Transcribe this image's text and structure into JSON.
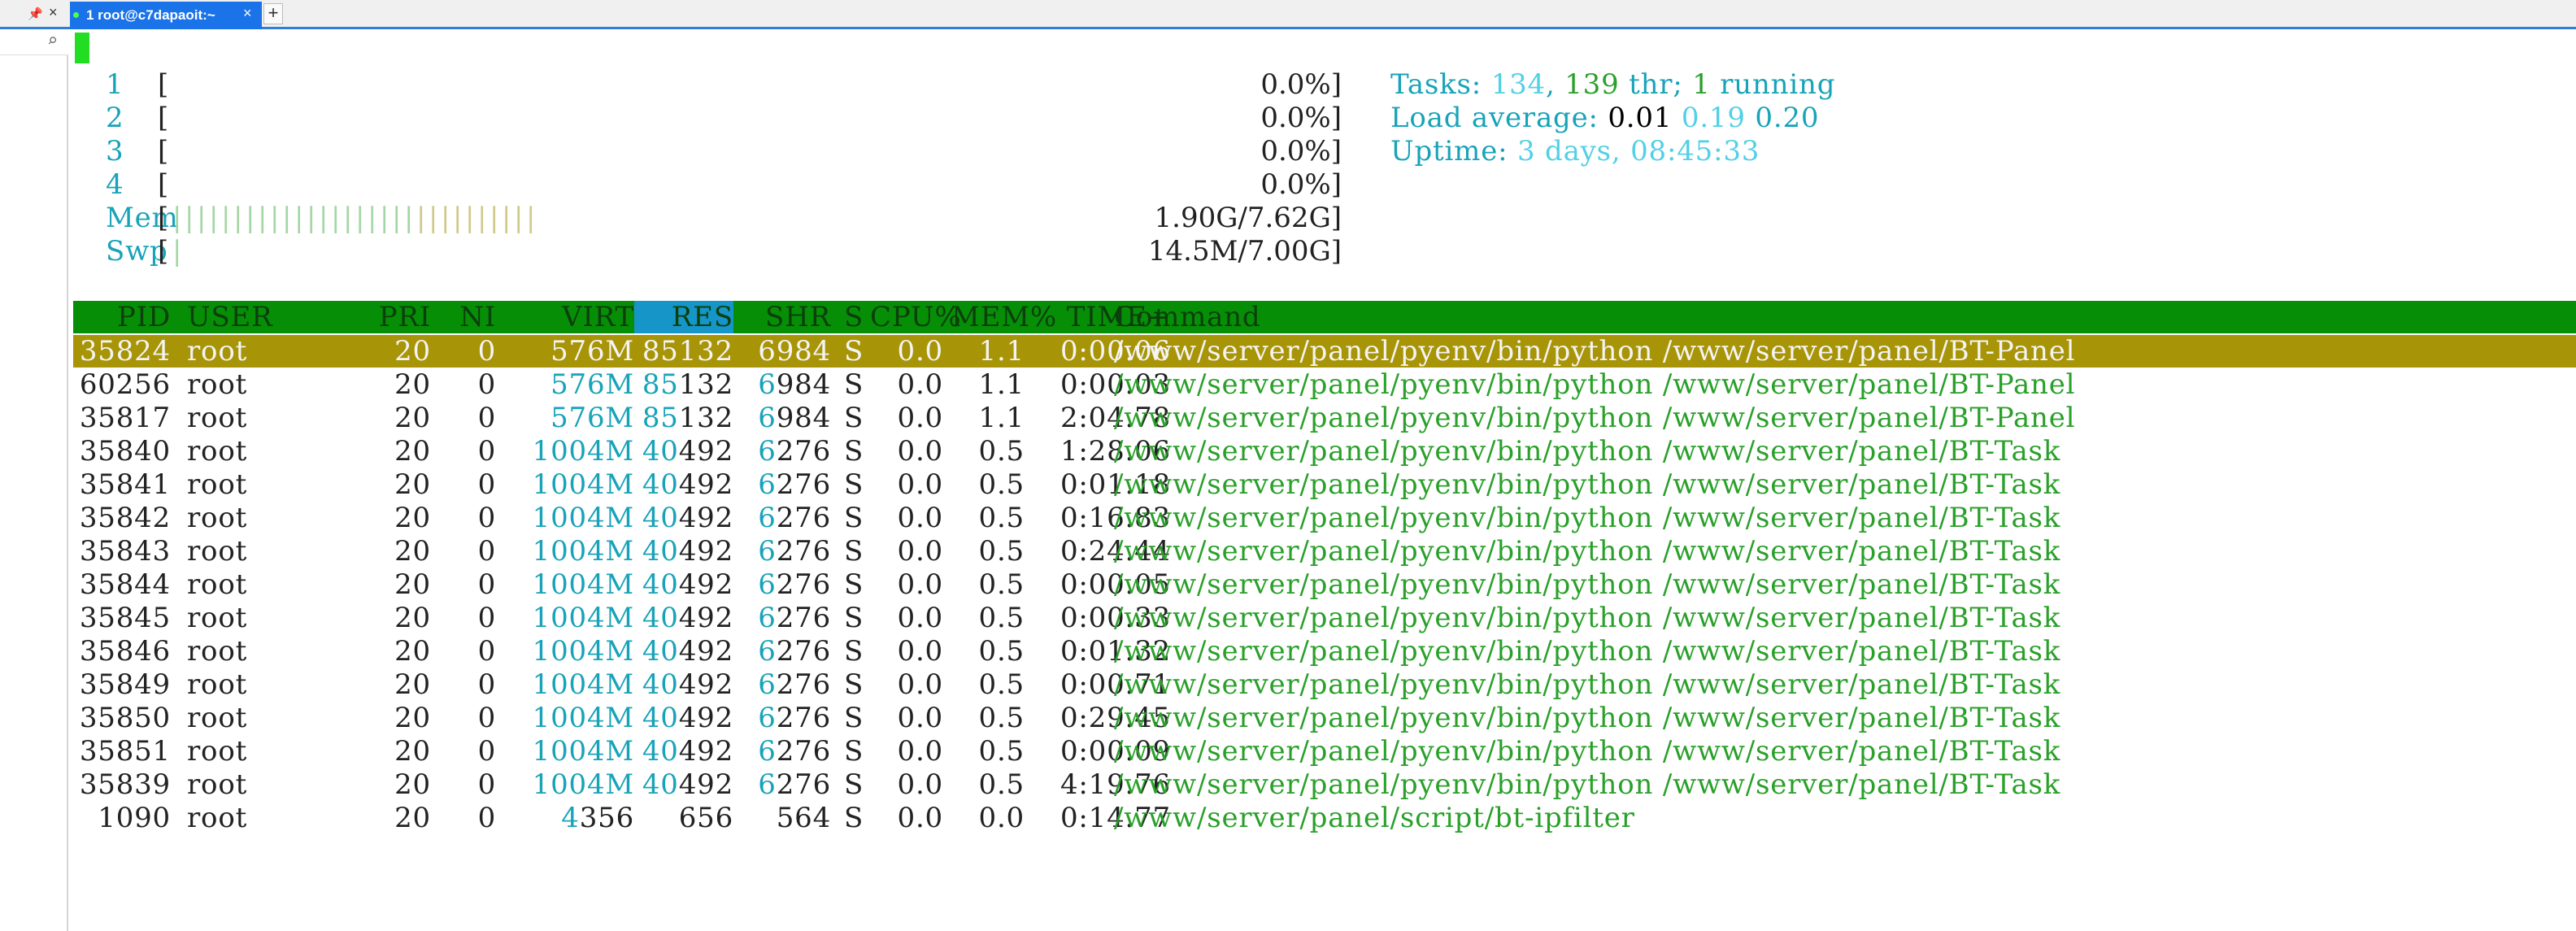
{
  "window": {
    "pin_icon": "pin-icon",
    "tab_title": "1 root@c7dapaoit:~",
    "tab_close": "×",
    "new_tab": "+"
  },
  "cpu_meters": [
    {
      "label": "1",
      "value": "0.0%"
    },
    {
      "label": "2",
      "value": "0.0%"
    },
    {
      "label": "3",
      "value": "0.0%"
    },
    {
      "label": "4",
      "value": "0.0%"
    }
  ],
  "mem_meter": {
    "label": "Mem",
    "value": "1.90G/7.62G",
    "fill_fraction": 0.25
  },
  "swp_meter": {
    "label": "Swp",
    "value": "14.5M/7.00G",
    "fill_fraction": 0.002
  },
  "stats": {
    "tasks_label": "Tasks:",
    "tasks_count": "134",
    "threads": "139",
    "thr_label": "thr;",
    "running_count": "1",
    "running_label": "running",
    "load_label": "Load average:",
    "load_1": "0.01",
    "load_5": "0.19",
    "load_15": "0.20",
    "uptime_label": "Uptime:",
    "uptime_value": "3 days, 08:45:33"
  },
  "columns": [
    "PID",
    "USER",
    "PRI",
    "NI",
    "VIRT",
    "RES",
    "SHR",
    "S",
    "CPU%",
    "MEM%",
    "TIME+",
    "Command"
  ],
  "sorted_column": "RES",
  "processes": [
    {
      "pid": "35824",
      "user": "root",
      "pri": "20",
      "ni": "0",
      "virt": "576M",
      "res": "85132",
      "shr": "6984",
      "s": "S",
      "cpu": "0.0",
      "mem": "1.1",
      "time": "0:00.06",
      "cmd": "/www/server/panel/pyenv/bin/python /www/server/panel/BT-Panel",
      "selected": true
    },
    {
      "pid": "60256",
      "user": "root",
      "pri": "20",
      "ni": "0",
      "virt": "576M",
      "res": "85132",
      "shr": "6984",
      "s": "S",
      "cpu": "0.0",
      "mem": "1.1",
      "time": "0:00.03",
      "cmd": "/www/server/panel/pyenv/bin/python /www/server/panel/BT-Panel"
    },
    {
      "pid": "35817",
      "user": "root",
      "pri": "20",
      "ni": "0",
      "virt": "576M",
      "res": "85132",
      "shr": "6984",
      "s": "S",
      "cpu": "0.0",
      "mem": "1.1",
      "time": "2:04.78",
      "cmd": "/www/server/panel/pyenv/bin/python /www/server/panel/BT-Panel"
    },
    {
      "pid": "35840",
      "user": "root",
      "pri": "20",
      "ni": "0",
      "virt": "1004M",
      "res": "40492",
      "shr": "6276",
      "s": "S",
      "cpu": "0.0",
      "mem": "0.5",
      "time": "1:28.06",
      "cmd": "/www/server/panel/pyenv/bin/python /www/server/panel/BT-Task"
    },
    {
      "pid": "35841",
      "user": "root",
      "pri": "20",
      "ni": "0",
      "virt": "1004M",
      "res": "40492",
      "shr": "6276",
      "s": "S",
      "cpu": "0.0",
      "mem": "0.5",
      "time": "0:01.18",
      "cmd": "/www/server/panel/pyenv/bin/python /www/server/panel/BT-Task"
    },
    {
      "pid": "35842",
      "user": "root",
      "pri": "20",
      "ni": "0",
      "virt": "1004M",
      "res": "40492",
      "shr": "6276",
      "s": "S",
      "cpu": "0.0",
      "mem": "0.5",
      "time": "0:16.83",
      "cmd": "/www/server/panel/pyenv/bin/python /www/server/panel/BT-Task"
    },
    {
      "pid": "35843",
      "user": "root",
      "pri": "20",
      "ni": "0",
      "virt": "1004M",
      "res": "40492",
      "shr": "6276",
      "s": "S",
      "cpu": "0.0",
      "mem": "0.5",
      "time": "0:24.44",
      "cmd": "/www/server/panel/pyenv/bin/python /www/server/panel/BT-Task"
    },
    {
      "pid": "35844",
      "user": "root",
      "pri": "20",
      "ni": "0",
      "virt": "1004M",
      "res": "40492",
      "shr": "6276",
      "s": "S",
      "cpu": "0.0",
      "mem": "0.5",
      "time": "0:00.05",
      "cmd": "/www/server/panel/pyenv/bin/python /www/server/panel/BT-Task"
    },
    {
      "pid": "35845",
      "user": "root",
      "pri": "20",
      "ni": "0",
      "virt": "1004M",
      "res": "40492",
      "shr": "6276",
      "s": "S",
      "cpu": "0.0",
      "mem": "0.5",
      "time": "0:00.33",
      "cmd": "/www/server/panel/pyenv/bin/python /www/server/panel/BT-Task"
    },
    {
      "pid": "35846",
      "user": "root",
      "pri": "20",
      "ni": "0",
      "virt": "1004M",
      "res": "40492",
      "shr": "6276",
      "s": "S",
      "cpu": "0.0",
      "mem": "0.5",
      "time": "0:01.32",
      "cmd": "/www/server/panel/pyenv/bin/python /www/server/panel/BT-Task"
    },
    {
      "pid": "35849",
      "user": "root",
      "pri": "20",
      "ni": "0",
      "virt": "1004M",
      "res": "40492",
      "shr": "6276",
      "s": "S",
      "cpu": "0.0",
      "mem": "0.5",
      "time": "0:00.71",
      "cmd": "/www/server/panel/pyenv/bin/python /www/server/panel/BT-Task"
    },
    {
      "pid": "35850",
      "user": "root",
      "pri": "20",
      "ni": "0",
      "virt": "1004M",
      "res": "40492",
      "shr": "6276",
      "s": "S",
      "cpu": "0.0",
      "mem": "0.5",
      "time": "0:29.45",
      "cmd": "/www/server/panel/pyenv/bin/python /www/server/panel/BT-Task"
    },
    {
      "pid": "35851",
      "user": "root",
      "pri": "20",
      "ni": "0",
      "virt": "1004M",
      "res": "40492",
      "shr": "6276",
      "s": "S",
      "cpu": "0.0",
      "mem": "0.5",
      "time": "0:00.09",
      "cmd": "/www/server/panel/pyenv/bin/python /www/server/panel/BT-Task"
    },
    {
      "pid": "35839",
      "user": "root",
      "pri": "20",
      "ni": "0",
      "virt": "1004M",
      "res": "40492",
      "shr": "6276",
      "s": "S",
      "cpu": "0.0",
      "mem": "0.5",
      "time": "4:19.76",
      "cmd": "/www/server/panel/pyenv/bin/python /www/server/panel/BT-Task"
    },
    {
      "pid": "1090",
      "user": "root",
      "pri": "20",
      "ni": "0",
      "virt": "4356",
      "res": "656",
      "shr": "564",
      "s": "S",
      "cpu": "0.0",
      "mem": "0.0",
      "time": "0:14.77",
      "cmd": "/www/server/panel/script/bt-ipfilter"
    }
  ],
  "colors": {
    "header_bg": "#078e07",
    "sorted_col_bg": "#1595c8",
    "selected_row_bg": "#a89407",
    "cursor": "#22dd22",
    "tab_active": "#1a73e8"
  }
}
